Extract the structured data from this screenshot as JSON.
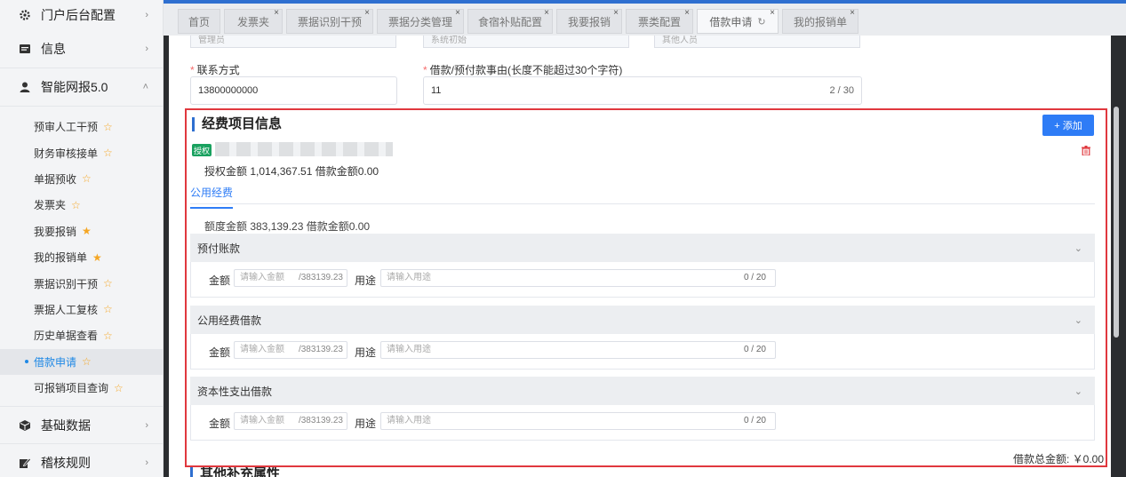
{
  "sidebar": {
    "group_portal": "门户后台配置",
    "group_info": "信息",
    "group_smart": "智能网报5.0",
    "sub_items": [
      {
        "label": "预审人工干预",
        "fav": "☆"
      },
      {
        "label": "财务审核接单",
        "fav": "☆"
      },
      {
        "label": "单据预收",
        "fav": "☆"
      },
      {
        "label": "发票夹",
        "fav": "☆"
      },
      {
        "label": "我要报销",
        "fav": "★"
      },
      {
        "label": "我的报销单",
        "fav": "★"
      },
      {
        "label": "票据识别干预",
        "fav": "☆"
      },
      {
        "label": "票据人工复核",
        "fav": "☆"
      },
      {
        "label": "历史单据查看",
        "fav": "☆"
      },
      {
        "label": "借款申请",
        "fav": "☆"
      },
      {
        "label": "可报销项目查询",
        "fav": "☆"
      }
    ],
    "group_basic": "基础数据",
    "group_audit": "稽核规则"
  },
  "tabs": [
    {
      "label": "首页"
    },
    {
      "label": "发票夹"
    },
    {
      "label": "票据识别干预"
    },
    {
      "label": "票据分类管理"
    },
    {
      "label": "食宿补贴配置"
    },
    {
      "label": "我要报销"
    },
    {
      "label": "票类配置"
    },
    {
      "label": "借款申请"
    },
    {
      "label": "我的报销单"
    }
  ],
  "form": {
    "stub1": "管理员",
    "stub2": "系统初始",
    "stub3": "其他人员",
    "contact_label": "联系方式",
    "contact_value": "13800000000",
    "reason_label": "借款/预付款事由(长度不能超过30个字符)",
    "reason_value": "11",
    "reason_count": "2 / 30"
  },
  "expense": {
    "title": "经费项目信息",
    "add_label": "+ 添加",
    "badge": "授权",
    "auth_line": "授权金额 1,014,367.51 借款金额0.00",
    "subtab": "公用经费",
    "quota_line": "额度金额 383,139.23 借款金额0.00",
    "amount_label": "金额",
    "amount_placeholder": "请输入金额",
    "amount_max": "/383139.23",
    "purpose_label": "用途",
    "purpose_placeholder": "请输入用途",
    "purpose_count": "0 / 20",
    "groups": [
      {
        "title": "预付账款"
      },
      {
        "title": "公用经费借款"
      },
      {
        "title": "资本性支出借款"
      }
    ],
    "total": "借款总金额: ￥0.00"
  },
  "next_section_title": "其他补充属性"
}
